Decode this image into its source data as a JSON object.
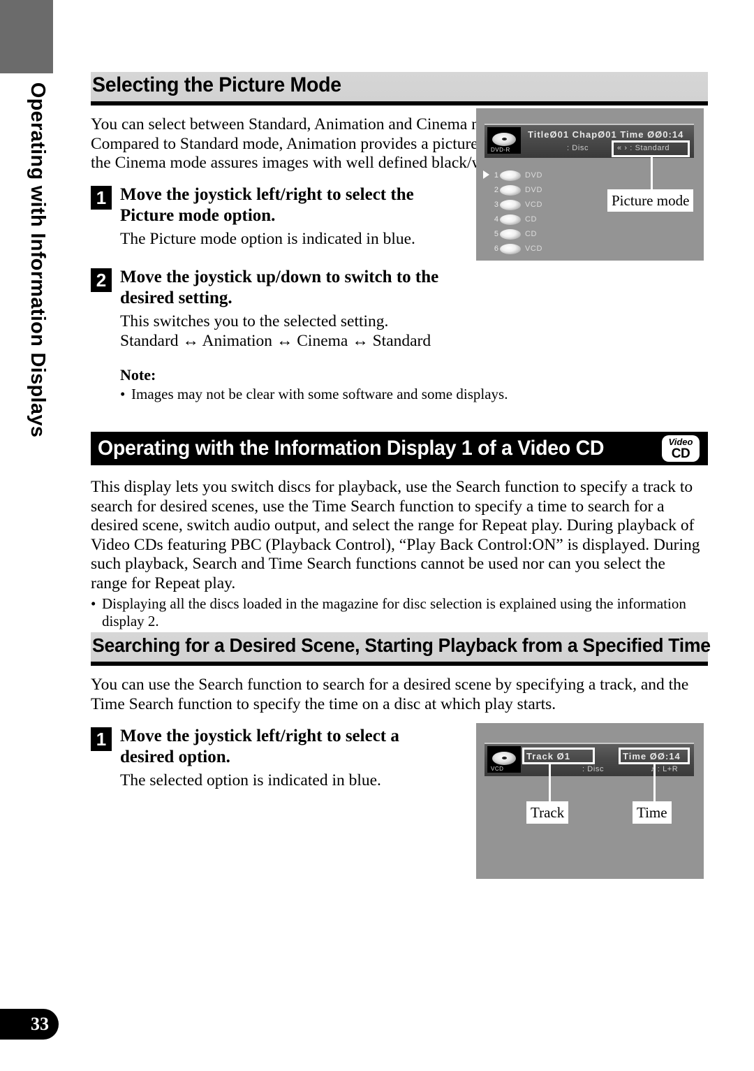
{
  "side_tab": {
    "label": "Operating with Information Displays"
  },
  "page": {
    "number": "33"
  },
  "section1": {
    "heading": "Selecting the Picture Mode",
    "intro": "You can select between Standard, Animation and Cinema modes.\nCompared to Standard mode, Animation provides a picture with beautifully clear colors and the Cinema mode assures images with well defined black/white contrast.",
    "steps": [
      {
        "num": "1",
        "title": "Move the joystick left/right to select the Picture mode option.",
        "desc": "The Picture mode option is indicated in blue."
      },
      {
        "num": "2",
        "title": "Move the joystick up/down to switch to the desired setting.",
        "desc": "This switches you to the selected setting.",
        "cycle": "Standard ↔ Animation ↔ Cinema ↔ Standard"
      }
    ],
    "note_heading": "Note:",
    "note_bullet_dot": "•",
    "note_bullet": "Images may not be clear with some software and some displays.",
    "screenshot": {
      "disc_badge": "DVD-R",
      "row1": "TitleØ01  ChapØ01  Time ØØ0:14",
      "row2_left_icon": "disc-icon",
      "row2_left": ": Disc",
      "row2_right": "« › : Standard",
      "callout": "Picture mode",
      "disc_list": [
        {
          "marker": "1",
          "type": "DVD",
          "playing": true
        },
        {
          "marker": "2",
          "type": "DVD",
          "playing": false
        },
        {
          "marker": "3",
          "type": "VCD",
          "playing": false
        },
        {
          "marker": "4",
          "type": "CD",
          "playing": false
        },
        {
          "marker": "5",
          "type": "CD",
          "playing": false
        },
        {
          "marker": "6",
          "type": "VCD",
          "playing": false
        }
      ]
    }
  },
  "section2": {
    "heading": "Operating with the Information Display 1 of a Video CD",
    "badge": {
      "top": "Video",
      "bottom": "CD"
    },
    "body": "This display lets you switch discs for playback, use the Search function to specify a track to search for desired scenes, use the Time Search function to specify a time to search for a desired scene, switch audio output, and select the range for Repeat play. During playback of Video CDs featuring PBC (Playback Control), “Play Back Control:ON” is displayed. During such playback, Search and Time Search functions cannot be used nor can you select the range for Repeat play.",
    "bullet_dot": "•",
    "bullet": "Displaying all the discs loaded in the magazine for disc selection is explained using the information display 2."
  },
  "section3": {
    "heading": "Searching for a Desired Scene, Starting Playback from a Specified Time",
    "intro": "You can use the Search function to search for a desired scene by specifying a track, and the Time Search function to specify the time on a disc at which play starts.",
    "steps": [
      {
        "num": "1",
        "title": "Move the joystick left/right to select a desired option.",
        "desc": "The selected option is indicated in blue."
      }
    ],
    "screenshot": {
      "disc_badge": "VCD",
      "track": "Track Ø1",
      "time": "Time    ØØ:14",
      "row2_left": ": Disc",
      "row2_right": "♪ : L+R",
      "callout_left": "Track",
      "callout_right": "Time"
    }
  },
  "colors": {
    "heading_band": "#d4d4d4",
    "heading_bar": "#000000",
    "screen_bg": "#949494",
    "osd_bar": "#4a4a4a",
    "side_tab": "#6b6b6b"
  }
}
